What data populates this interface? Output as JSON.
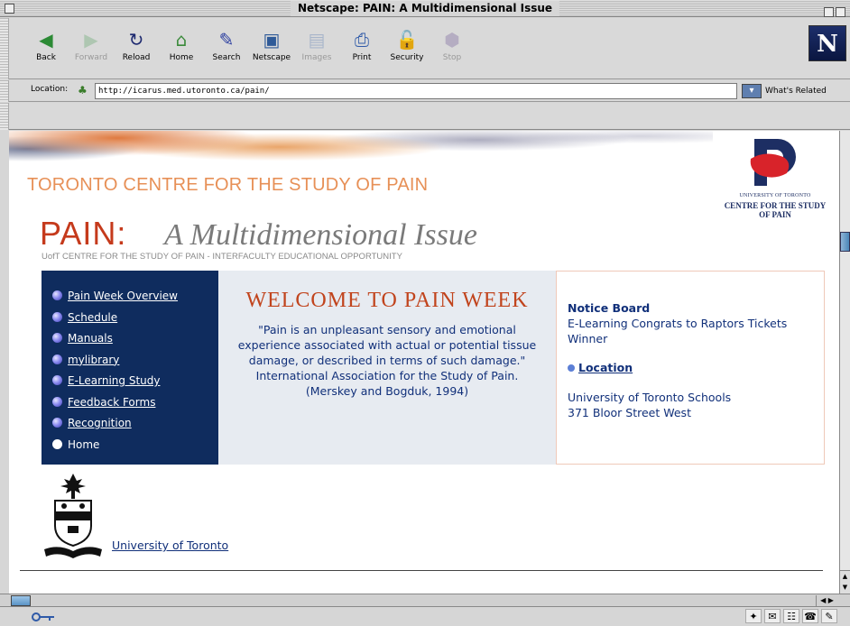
{
  "window": {
    "title": "Netscape: PAIN: A Multidimensional Issue"
  },
  "toolbar": {
    "buttons": [
      {
        "label": "Back",
        "icon": "back-arrow-icon",
        "glyph": "◀",
        "color": "#2c8a35",
        "disabled": false
      },
      {
        "label": "Forward",
        "icon": "forward-arrow-icon",
        "glyph": "▶",
        "color": "#7bb082",
        "disabled": true
      },
      {
        "label": "Reload",
        "icon": "reload-icon",
        "glyph": "↻",
        "color": "#1e2a70",
        "disabled": false
      },
      {
        "label": "Home",
        "icon": "home-icon",
        "glyph": "⌂",
        "color": "#3a8a3a",
        "disabled": false
      },
      {
        "label": "Search",
        "icon": "search-icon",
        "glyph": "✎",
        "color": "#2b3ea0",
        "disabled": false
      },
      {
        "label": "Netscape",
        "icon": "netscape-icon",
        "glyph": "▣",
        "color": "#2f5a98",
        "disabled": false
      },
      {
        "label": "Images",
        "icon": "images-icon",
        "glyph": "▤",
        "color": "#6f8bb8",
        "disabled": true
      },
      {
        "label": "Print",
        "icon": "print-icon",
        "glyph": "⎙",
        "color": "#2f5aa8",
        "disabled": false
      },
      {
        "label": "Security",
        "icon": "security-lock-icon",
        "glyph": "🔓",
        "color": "#c03a2a",
        "disabled": false
      },
      {
        "label": "Stop",
        "icon": "stop-icon",
        "glyph": "⬢",
        "color": "#8a7aa8",
        "disabled": true
      }
    ],
    "brand_letter": "N"
  },
  "location": {
    "label": "Location:",
    "url": "http://icarus.med.utoronto.ca/pain/",
    "related_label": "What's Related"
  },
  "page": {
    "centre_title": "TORONTO CENTRE FOR THE STUDY OF PAIN",
    "logo_line1": "UNIVERSITY OF TORONTO",
    "logo_line2": "CENTRE FOR THE STUDY OF PAIN",
    "pain_word": "PAIN:",
    "pain_subtitle": "A Multidimensional Issue",
    "tagline": "UofT CENTRE FOR THE STUDY OF PAIN - INTERFACULTY EDUCATIONAL OPPORTUNITY",
    "nav": [
      {
        "label": "Pain Week Overview",
        "bullet": "blue",
        "link": true
      },
      {
        "label": "Schedule",
        "bullet": "blue",
        "link": true
      },
      {
        "label": "Manuals",
        "bullet": "blue",
        "link": true
      },
      {
        "label": "mylibrary",
        "bullet": "blue",
        "link": true
      },
      {
        "label": "E-Learning Study",
        "bullet": "blue",
        "link": true
      },
      {
        "label": "Feedback Forms",
        "bullet": "blue",
        "link": true
      },
      {
        "label": "Recognition",
        "bullet": "blue",
        "link": true
      },
      {
        "label": "Home",
        "bullet": "white",
        "link": false
      }
    ],
    "welcome_heading": "WELCOME TO PAIN WEEK",
    "welcome_quote": "\"Pain is an unpleasant sensory and emotional experience associated with actual or potential tissue damage, or described in terms of such damage.\" International Association for the Study of Pain.",
    "welcome_citation": "(Merskey and Bogduk, 1994)",
    "notice_heading": "Notice Board",
    "notice_text": "E-Learning Congrats to Raptors Tickets Winner",
    "location_link": "Location",
    "address_line1": "University of Toronto Schools",
    "address_line2": "371 Bloor Street West",
    "uoft_link": "University of Toronto"
  },
  "colors": {
    "nav_bg": "#0f2c5e",
    "welcome_bg": "#e7ebf1",
    "heading_red": "#c1441d",
    "link_blue": "#11307a"
  }
}
